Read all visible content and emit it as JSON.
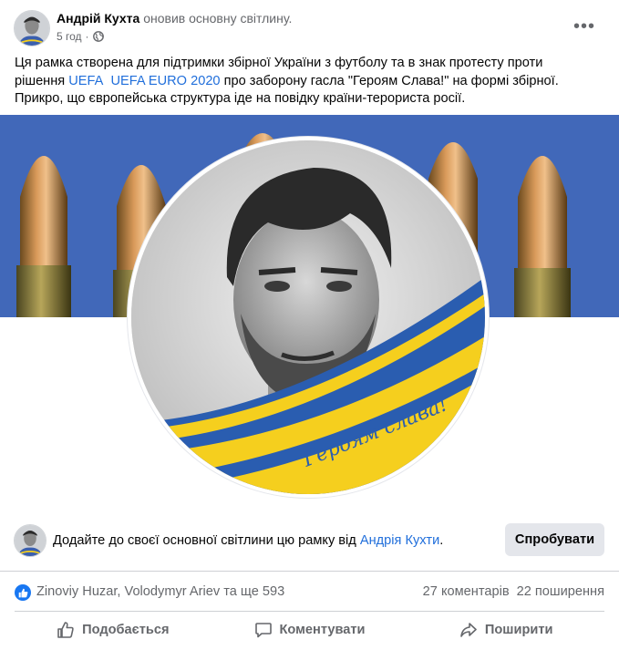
{
  "post": {
    "author": "Андрій Кухта",
    "action_text": "оновив основну світлину.",
    "time": "5 год",
    "dot": "·",
    "text": {
      "line1": "Ця рамка створена для підтримки збірної України з футболу та в знак протесту проти",
      "line2_a": "рішення ",
      "link1": "UEFA",
      "link2": "UEFA EURO 2020",
      "line2_b": " про заборону гасла \"Героям Слава!\" на формі збірної.",
      "line3": "Прикро, що європейська структура іде на повідку країни-терориста росії."
    },
    "photo_caption": "Героям слава!"
  },
  "frame_bar": {
    "text_prefix": "Додайте до своєї основної світлини цю рамку від ",
    "author_link": "Андрія Кухти",
    "text_suffix": ".",
    "try_button": "Спробувати"
  },
  "stats": {
    "reactors": "Zinoviy Huzar, Volodymyr Ariev та ще 593",
    "comments": "27 коментарів",
    "shares": "22 поширення"
  },
  "actions": {
    "like": "Подобається",
    "comment": "Коментувати",
    "share": "Поширити"
  },
  "icons": {
    "more": "more-horizontal-icon",
    "globe": "globe-icon",
    "like_badge": "thumbs-up-icon",
    "like": "thumbs-up-outline-icon",
    "comment": "speech-bubble-icon",
    "share": "share-arrow-icon"
  },
  "colors": {
    "link": "#216fdb",
    "secondary_text": "#65676b",
    "button_bg": "#e4e6eb",
    "like_blue": "#1877f2",
    "ukraine_blue": "#2a5db0",
    "ukraine_yellow": "#f5cf1e"
  }
}
